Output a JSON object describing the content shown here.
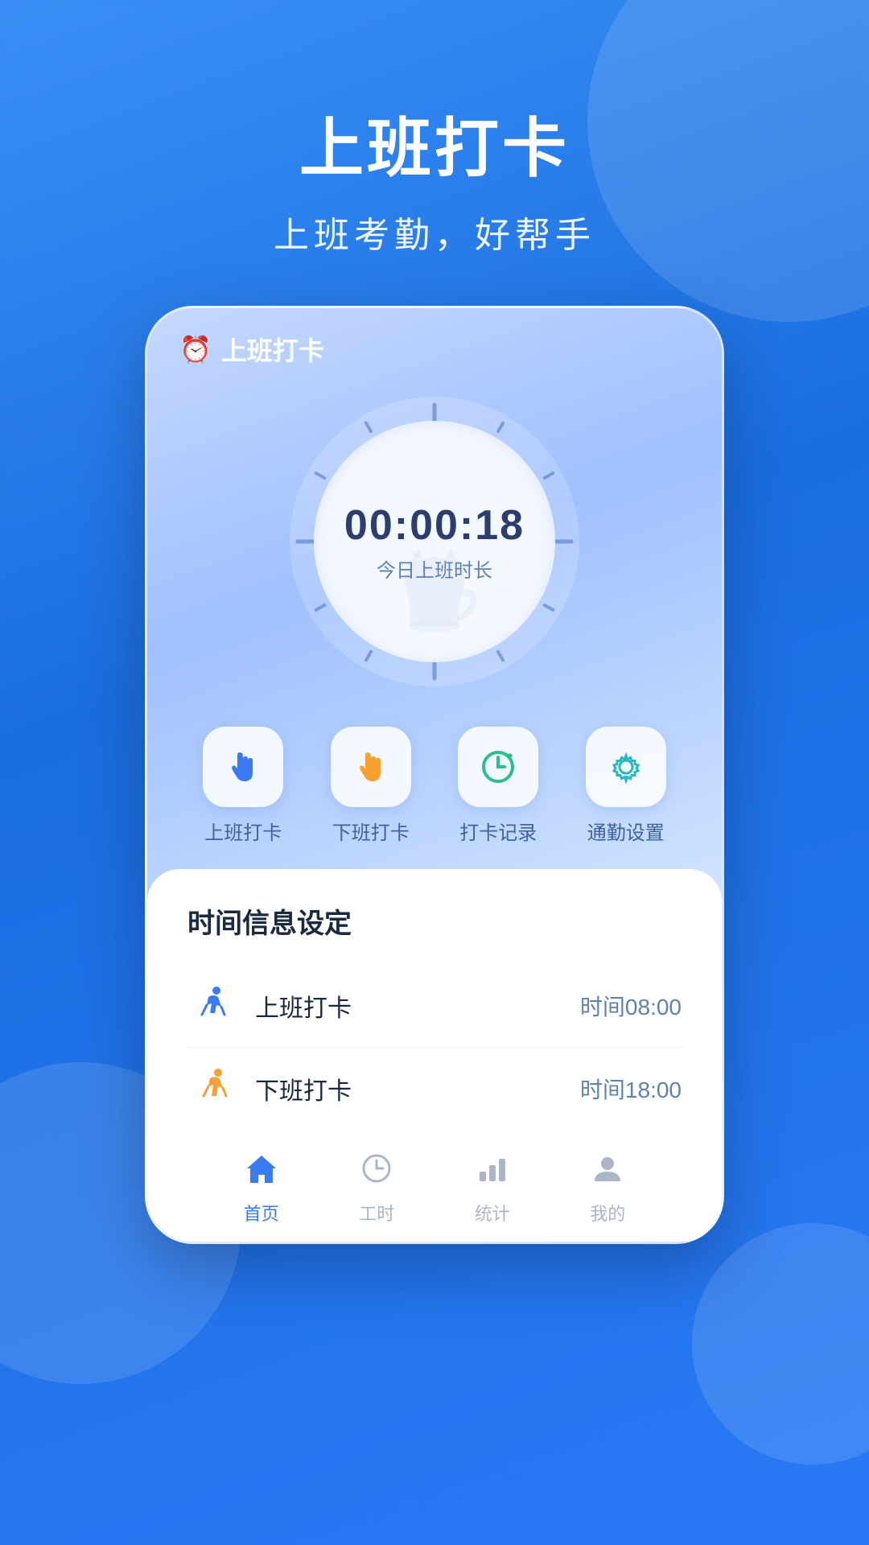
{
  "app": {
    "title": "上班打卡",
    "subtitle": "上班考勤，好帮手"
  },
  "phone": {
    "top_label": "上班打卡",
    "clock": {
      "time": "00:00:18",
      "label": "今日上班时长"
    },
    "actions": [
      {
        "id": "checkin",
        "label": "上班打卡",
        "icon": "👆",
        "icon_color": "blue"
      },
      {
        "id": "checkout",
        "label": "下班打卡",
        "icon": "👆",
        "icon_color": "orange"
      },
      {
        "id": "records",
        "label": "打卡记录",
        "icon": "🔄",
        "icon_color": "green"
      },
      {
        "id": "settings",
        "label": "通勤设置",
        "icon": "⚙️",
        "icon_color": "teal"
      }
    ],
    "section_title": "时间信息设定",
    "schedules": [
      {
        "id": "start",
        "icon": "🏃",
        "icon_color": "blue",
        "name": "上班打卡",
        "time": "时间08:00"
      },
      {
        "id": "end",
        "icon": "🏃",
        "icon_color": "orange",
        "name": "下班打卡",
        "time": "时间18:00"
      }
    ],
    "nav": [
      {
        "id": "home",
        "label": "首页",
        "icon": "🏠",
        "active": true
      },
      {
        "id": "hours",
        "label": "工时",
        "icon": "🕐",
        "active": false
      },
      {
        "id": "stats",
        "label": "统计",
        "icon": "📊",
        "active": false
      },
      {
        "id": "profile",
        "label": "我的",
        "icon": "👤",
        "active": false
      }
    ]
  },
  "colors": {
    "primary": "#3a7af5",
    "orange": "#f5a030",
    "teal": "#28b8c0",
    "green": "#28c090",
    "text_dark": "#1a2840",
    "text_muted": "#6080b0"
  }
}
